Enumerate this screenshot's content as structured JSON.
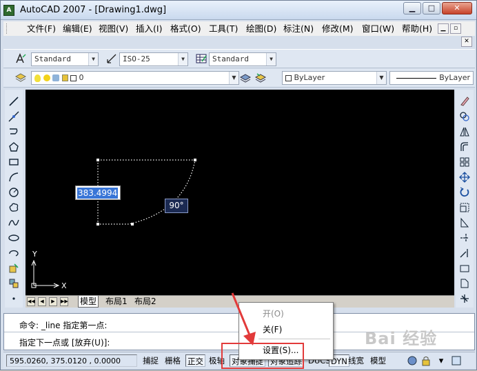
{
  "window": {
    "title": "AutoCAD 2007 - [Drawing1.dwg]",
    "controls": {
      "minimize": "▁",
      "maximize": "□",
      "close": "✕"
    },
    "mdi_controls": {
      "minimize": "▁",
      "restore": "▫",
      "close": "✕"
    }
  },
  "menu": {
    "items": [
      "文件(F)",
      "编辑(E)",
      "视图(V)",
      "插入(I)",
      "格式(O)",
      "工具(T)",
      "绘图(D)",
      "标注(N)",
      "修改(M)",
      "窗口(W)",
      "帮助(H)"
    ]
  },
  "styles_toolbar": {
    "text_style": "Standard",
    "dim_style": "ISO-25",
    "table_style": "Standard"
  },
  "layers_toolbar": {
    "layer_name": "0",
    "color": "ByLayer",
    "linetype": "ByLayer"
  },
  "drawing": {
    "dynamic_input_value": "383.4994",
    "angle_value": "90°",
    "ucs_x": "X",
    "ucs_y": "Y"
  },
  "layout_tabs": [
    "模型",
    "布局1",
    "布局2"
  ],
  "command": {
    "line1": "命令:  _line 指定第一点:",
    "line2": "指定下一点或 [放弃(U)]:"
  },
  "status": {
    "coordinates": "595.0260,  375.0120 , 0.0000",
    "buttons": [
      "捕捉",
      "栅格",
      "正交",
      "极轴",
      "对象捕捉",
      "对象追踪",
      "DUCS",
      "DYN",
      "线宽",
      "模型"
    ]
  },
  "context_menu": {
    "items": [
      "开(O)",
      "关(F)",
      "设置(S)..."
    ]
  },
  "watermark": "Bai 经验",
  "colors": {
    "highlight": "#e23a3a",
    "canvas": "#000000",
    "selection": "#3875d7"
  }
}
